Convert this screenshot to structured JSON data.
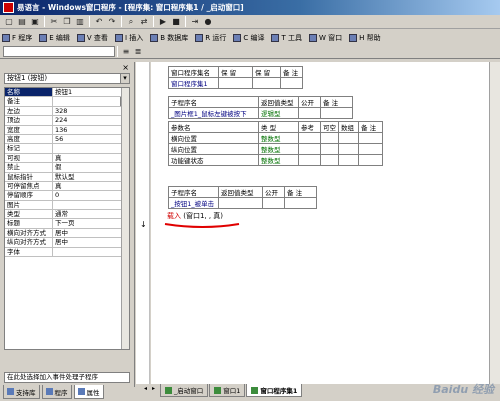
{
  "window": {
    "title": "易语言 - Windows窗口程序 - [程序集: 窗口程序集1 / _启动窗口]"
  },
  "menu": {
    "items": [
      {
        "label": "F 程序"
      },
      {
        "label": "E 编辑"
      },
      {
        "label": "V 查看"
      },
      {
        "label": "I 插入"
      },
      {
        "label": "B 数据库"
      },
      {
        "label": "R 运行"
      },
      {
        "label": "C 编译"
      },
      {
        "label": "T 工具"
      },
      {
        "label": "W 窗口"
      },
      {
        "label": "H 帮助"
      }
    ]
  },
  "leftpanel": {
    "object_select": "按钮1 (按钮)",
    "properties": [
      {
        "name": "名称",
        "value": "按钮1",
        "selected": true
      },
      {
        "name": "备注",
        "value": "",
        "ellipsis": true
      },
      {
        "name": "左边",
        "value": "328"
      },
      {
        "name": "顶边",
        "value": "224"
      },
      {
        "name": "宽度",
        "value": "136"
      },
      {
        "name": "高度",
        "value": "56"
      },
      {
        "name": "标记",
        "value": ""
      },
      {
        "name": "可视",
        "value": "真"
      },
      {
        "name": "禁止",
        "value": "假"
      },
      {
        "name": "鼠标指针",
        "value": "默认型"
      },
      {
        "name": "可停留焦点",
        "value": "真"
      },
      {
        "name": "停留顺序",
        "value": "0"
      },
      {
        "name": "图片",
        "value": ""
      },
      {
        "name": "类型",
        "value": "通常"
      },
      {
        "name": "标题",
        "value": "下一页"
      },
      {
        "name": "横向对齐方式",
        "value": "居中"
      },
      {
        "name": "纵向对齐方式",
        "value": "居中"
      },
      {
        "name": "字体",
        "value": ""
      }
    ],
    "event_hint": "在此处选择加入事件处理子程序",
    "tabs": [
      {
        "label": "支持库"
      },
      {
        "label": "程序"
      },
      {
        "label": "属性"
      }
    ]
  },
  "editor": {
    "assembly_table": {
      "headers": [
        "窗口程序集名",
        "保 留",
        "保 留",
        "备 注"
      ],
      "row": [
        "窗口程序集1",
        "",
        "",
        ""
      ]
    },
    "sub1_table": {
      "headers": [
        "子程序名",
        "返回值类型",
        "公开",
        "备 注"
      ],
      "row": [
        "_图片框1_鼠标左键被按下",
        "逻辑型",
        "",
        ""
      ],
      "param_headers": [
        "参数名",
        "类 型",
        "参考",
        "可空",
        "数组",
        "备 注"
      ],
      "params": [
        [
          "横向位置",
          "整数型",
          "",
          "",
          "",
          ""
        ],
        [
          "纵向位置",
          "整数型",
          "",
          "",
          "",
          ""
        ],
        [
          "功能键状态",
          "整数型",
          "",
          "",
          "",
          ""
        ]
      ]
    },
    "sub2_table": {
      "headers": [
        "子程序名",
        "返回值类型",
        "公开",
        "备 注"
      ],
      "row": [
        "_按钮1_被单击",
        "",
        "",
        ""
      ]
    },
    "code_keyword": "载入",
    "code_args": " (窗口1, , 真)"
  },
  "bottom_tabs": [
    {
      "label": "_启动窗口",
      "active": false
    },
    {
      "label": "窗口1",
      "active": false
    },
    {
      "label": "窗口程序集1",
      "active": true
    }
  ],
  "watermark": "Baidu 经验",
  "colors": {
    "title_start": "#0a246a",
    "title_end": "#a6caf0",
    "annotation_red": "#e00000",
    "code_keyword": "#d00000"
  }
}
